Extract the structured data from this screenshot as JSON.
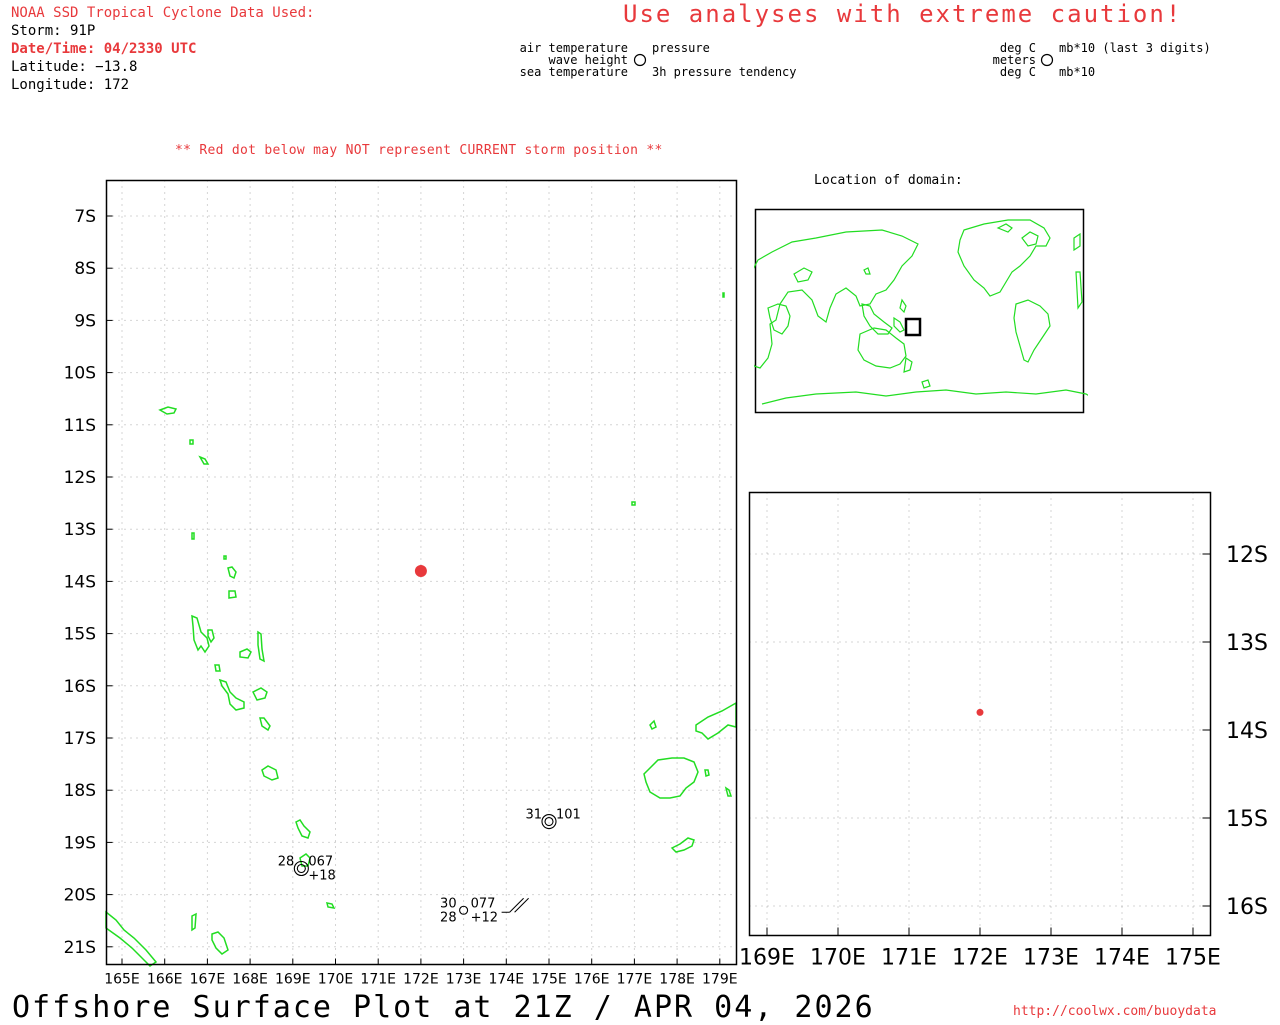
{
  "header": {
    "source": "NOAA SSD Tropical Cyclone Data Used:",
    "storm": "Storm: 91P",
    "datetime": "Date/Time: 04/2330 UTC",
    "latitude": "Latitude: −13.8",
    "longitude": "Longitude: 172"
  },
  "caution": "Use analyses with extreme caution!",
  "legend": {
    "left_top_left": "air temperature",
    "left_mid_left": "wave height",
    "left_bot_left": "sea temperature",
    "left_top_right": "pressure",
    "left_bot_right": "3h pressure tendency",
    "right_top_left": "deg C",
    "right_mid_left": "meters",
    "right_bot_left": "deg C",
    "right_top_right": "mb*10 (last 3 digits)",
    "right_bot_right": "mb*10"
  },
  "red_dot_note": "** Red dot below may NOT represent CURRENT storm position **",
  "location_title": "Location of domain:",
  "footer": {
    "title": "Offshore Surface Plot at 21Z / APR 04, 2026",
    "url": "http://coolwx.com/buoydata"
  },
  "colors": {
    "storm": "#e8393c",
    "land": "#22dd22",
    "text_red": "#e8393c"
  },
  "main_map": {
    "lon_labels": [
      "165E",
      "166E",
      "167E",
      "168E",
      "169E",
      "170E",
      "171E",
      "172E",
      "173E",
      "174E",
      "175E",
      "176E",
      "177E",
      "178E",
      "179E"
    ],
    "lon_values": [
      165,
      166,
      167,
      168,
      169,
      170,
      171,
      172,
      173,
      174,
      175,
      176,
      177,
      178,
      179
    ],
    "lat_labels": [
      "7S",
      "8S",
      "9S",
      "10S",
      "11S",
      "12S",
      "13S",
      "14S",
      "15S",
      "16S",
      "17S",
      "18S",
      "19S",
      "20S",
      "21S"
    ],
    "lat_values": [
      -7,
      -8,
      -9,
      -10,
      -11,
      -12,
      -13,
      -14,
      -15,
      -16,
      -17,
      -18,
      -19,
      -20,
      -21
    ],
    "storm": {
      "lon": 172,
      "lat": -13.8
    },
    "stations": [
      {
        "lon": 169.2,
        "lat": -19.5,
        "air": "28",
        "pressure": "067",
        "tendency": "+18"
      },
      {
        "lon": 175.0,
        "lat": -18.6,
        "air": "31",
        "pressure": "101"
      },
      {
        "lon": 173.0,
        "lat": -20.3,
        "air": "30",
        "pressure": "077",
        "sea": "28",
        "tendency": "+12"
      }
    ]
  },
  "zoom_map": {
    "lon_labels": [
      "169E",
      "170E",
      "171E",
      "172E",
      "173E",
      "174E",
      "175E"
    ],
    "lon_values": [
      169,
      170,
      171,
      172,
      173,
      174,
      175
    ],
    "lat_labels": [
      "12S",
      "13S",
      "14S",
      "15S",
      "16S"
    ],
    "lat_values": [
      -12,
      -13,
      -14,
      -15,
      -16
    ],
    "storm": {
      "lon": 172,
      "lat": -13.8
    }
  }
}
